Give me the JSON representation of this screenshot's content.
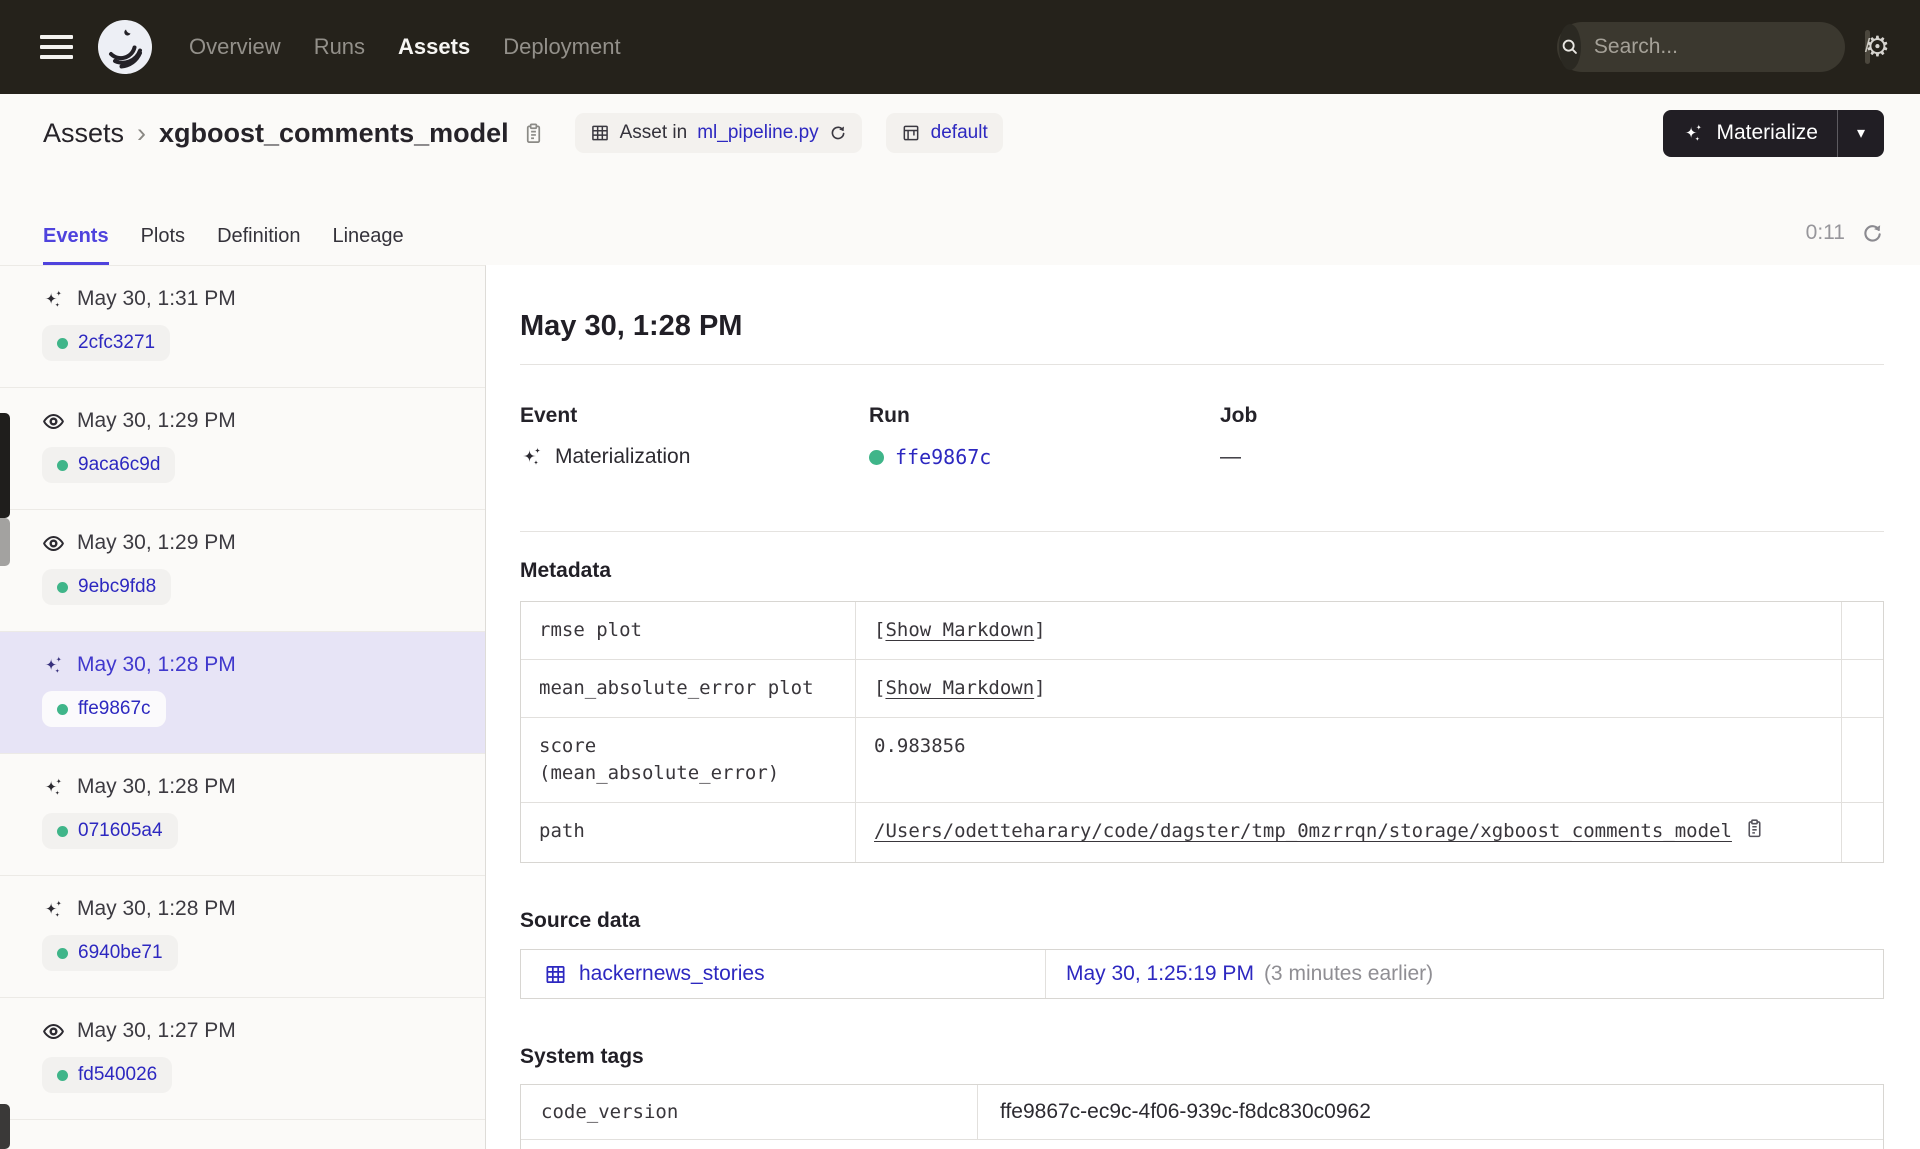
{
  "topnav": {
    "menu": {
      "items": [
        {
          "label": "Overview"
        },
        {
          "label": "Runs"
        },
        {
          "label": "Assets"
        },
        {
          "label": "Deployment"
        }
      ],
      "active": "Assets"
    },
    "search": {
      "placeholder": "Search...",
      "shortcut": "/"
    }
  },
  "page_header": {
    "breadcrumb": {
      "root": "Assets",
      "separator": "›",
      "current": "xgboost_comments_model"
    },
    "location_badge": {
      "prefix": "Asset in",
      "file": "ml_pipeline.py"
    },
    "job_badge": {
      "label": "default"
    },
    "materialize": {
      "label": "Materialize"
    }
  },
  "tabs": {
    "items": [
      {
        "label": "Events"
      },
      {
        "label": "Plots"
      },
      {
        "label": "Definition"
      },
      {
        "label": "Lineage"
      }
    ],
    "active": "Events",
    "timer": "0:11"
  },
  "sidebar": {
    "events": [
      {
        "type": "materialization",
        "timestamp": "May 30, 1:31 PM",
        "run_id": "2cfc3271",
        "selected": false
      },
      {
        "type": "observation",
        "timestamp": "May 30, 1:29 PM",
        "run_id": "9aca6c9d",
        "selected": false
      },
      {
        "type": "observation",
        "timestamp": "May 30, 1:29 PM",
        "run_id": "9ebc9fd8",
        "selected": false
      },
      {
        "type": "materialization",
        "timestamp": "May 30, 1:28 PM",
        "run_id": "ffe9867c",
        "selected": true
      },
      {
        "type": "materialization",
        "timestamp": "May 30, 1:28 PM",
        "run_id": "071605a4",
        "selected": false
      },
      {
        "type": "materialization",
        "timestamp": "May 30, 1:28 PM",
        "run_id": "6940be71",
        "selected": false
      },
      {
        "type": "observation",
        "timestamp": "May 30, 1:27 PM",
        "run_id": "fd540026",
        "selected": false
      }
    ]
  },
  "detail": {
    "title": "May 30, 1:28 PM",
    "event": {
      "label": "Event",
      "value": "Materialization"
    },
    "run": {
      "label": "Run",
      "value": "ffe9867c"
    },
    "job": {
      "label": "Job",
      "value": "—"
    },
    "metadata": {
      "heading": "Metadata",
      "rows": [
        {
          "key": "rmse plot",
          "bracket_open": "[",
          "link": "Show Markdown",
          "bracket_close": "]"
        },
        {
          "key": "mean_absolute_error plot",
          "bracket_open": "[",
          "link": "Show Markdown",
          "bracket_close": "]"
        },
        {
          "key": "score (mean_absolute_error)",
          "value": "0.983856"
        },
        {
          "key": "path",
          "link": "/Users/odetteharary/code/dagster/tmp_0mzrrqn/storage/xgboost_comments_model"
        }
      ]
    },
    "source_data": {
      "heading": "Source data",
      "asset": "hackernews_stories",
      "timestamp": "May 30, 1:25:19 PM",
      "note": "(3 minutes earlier)"
    },
    "system_tags": {
      "heading": "System tags",
      "rows": [
        {
          "key": "code_version",
          "value": "ffe9867c-ec9c-4f06-939c-f8dc830c0962"
        }
      ]
    }
  },
  "colors": {
    "topnav_bg": "#25221b",
    "accent": "#4f43dd",
    "link": "#2d28c0",
    "success_green": "#3fb589",
    "selected_row_bg": "#e7e4f6"
  }
}
